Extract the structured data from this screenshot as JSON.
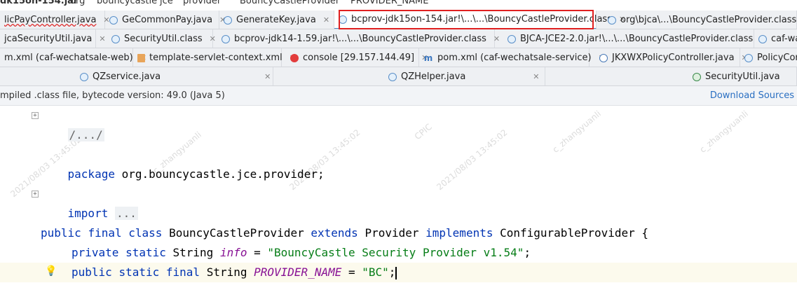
{
  "breadcrumb": [
    "dk15on-154.jar",
    "org",
    "bouncycastle",
    "jce",
    "provider",
    "BouncyCastleProvider",
    "PROVIDER_NAME"
  ],
  "tabs_row1": [
    {
      "label": "licPayController.java",
      "icon": "class"
    },
    {
      "label": "GeCommonPay.java",
      "icon": "class"
    },
    {
      "label": "GenerateKey.java",
      "icon": "class"
    },
    {
      "label": "bcprov-jdk15on-154.jar!\\...\\...\\BouncyCastleProvider.class",
      "icon": "class"
    },
    {
      "label": "org\\bjca\\...\\BouncyCastleProvider.class",
      "icon": "class"
    }
  ],
  "tabs_row2": [
    {
      "label": "jcaSecurityUtil.java",
      "icon": "class"
    },
    {
      "label": "SecurityUtil.class",
      "icon": "class"
    },
    {
      "label": "bcprov-jdk14-1.59.jar!\\...\\...\\BouncyCastleProvider.class",
      "icon": "class"
    },
    {
      "label": "BJCA-JCE2-2.0.jar!\\...\\...\\BouncyCastleProvider.class",
      "icon": "class"
    },
    {
      "label": "caf-wa",
      "icon": "class"
    }
  ],
  "tabs_row3": [
    {
      "label": "m.xml (caf-wechatsale-web)",
      "icon": "m"
    },
    {
      "label": "template-servlet-context.xml",
      "icon": "xml"
    },
    {
      "label": "console [29.157.144.49]",
      "icon": "console"
    },
    {
      "label": "pom.xml (caf-wechatsale-service)",
      "icon": "m"
    },
    {
      "label": "JKXWXPolicyController.java",
      "icon": "class"
    },
    {
      "label": "PolicyCor",
      "icon": "class"
    }
  ],
  "tabs_row4": [
    {
      "label": "QZservice.java",
      "icon": "class"
    },
    {
      "label": "QZHelper.java",
      "icon": "class"
    },
    {
      "label": "SecurityUtil.java",
      "icon": "util"
    }
  ],
  "infobar": {
    "message": "mpiled .class file, bytecode version: 49.0 (Java 5)",
    "download_link": "Download Sources"
  },
  "code": {
    "fold_header": "/.../",
    "package_kw": "package",
    "package_name": " org.bouncycastle.jce.provider;",
    "import_kw": "import",
    "import_fold": "...",
    "class_line": {
      "public": "public",
      "final": "final",
      "class": "class",
      "name": "BouncyCastleProvider",
      "extends": "extends",
      "parent": "Provider",
      "implements": "implements",
      "iface": "ConfigurableProvider {"
    },
    "field1": {
      "private": "private",
      "static": "static",
      "type": "String",
      "name": "info",
      "eq": " = ",
      "value": "\"BouncyCastle Security Provider v1.54\"",
      "semi": ";"
    },
    "field2": {
      "public": "public",
      "static": "static",
      "final": "final",
      "type": "String",
      "name": "PROVIDER_NAME",
      "eq": " = ",
      "value": "\"BC\"",
      "semi": ";"
    }
  },
  "watermark": {
    "user": "c_zhangyuanli",
    "org": "CPIC",
    "timestamp": "2021/08/03 13:45:02"
  },
  "colors": {
    "keyword": "#0033b3",
    "string": "#067d17",
    "field": "#871094",
    "highlight_border": "#e02020",
    "link": "#2a6fc2"
  }
}
